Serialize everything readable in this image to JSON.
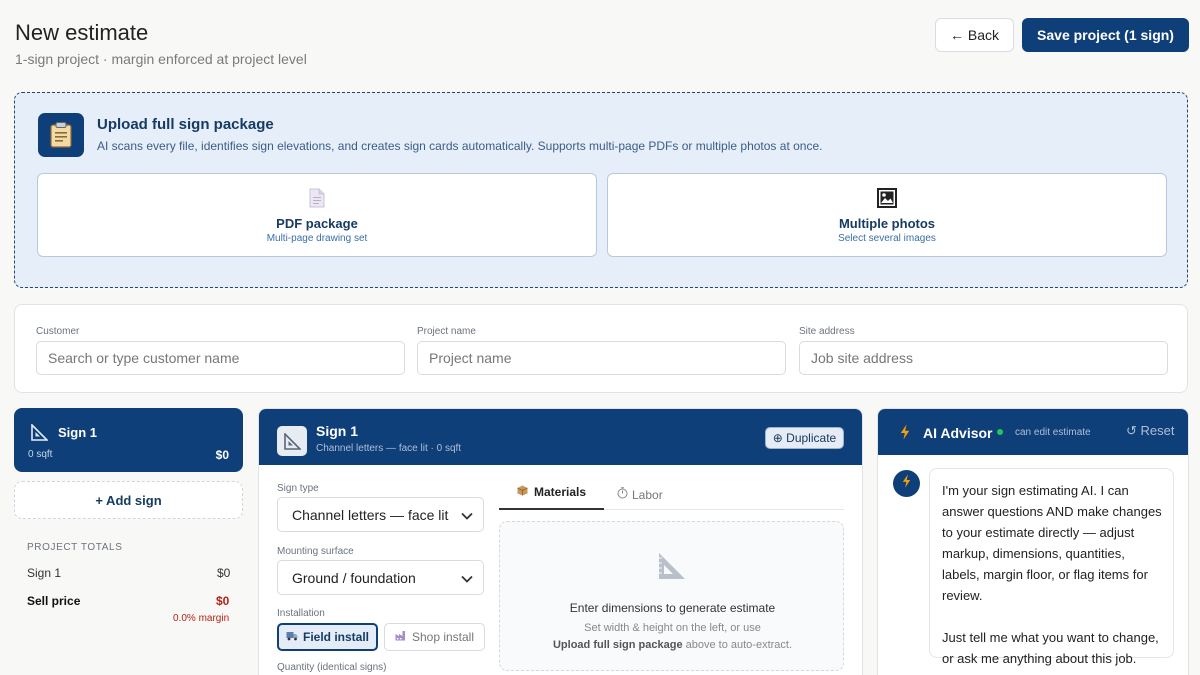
{
  "header": {
    "title": "New estimate",
    "subtitle": "1-sign project · margin enforced at project level",
    "back_label": "← Back",
    "save_label": "Save project (1 sign)"
  },
  "upload": {
    "title": "Upload full sign package",
    "description": "AI scans every file, identifies sign elevations, and creates sign cards automatically. Supports multi-page PDFs or multiple photos at once.",
    "pdf": {
      "label": "PDF package",
      "hint": "Multi-page drawing set",
      "icon": "document-icon"
    },
    "photos": {
      "label": "Multiple photos",
      "hint": "Select several images",
      "icon": "photos-icon"
    }
  },
  "fields": {
    "customer": {
      "label": "Customer",
      "placeholder": "Search or type customer name"
    },
    "project": {
      "label": "Project name",
      "placeholder": "Project name"
    },
    "site": {
      "label": "Site address",
      "placeholder": "Job site address"
    }
  },
  "sidebar": {
    "sign": {
      "name": "Sign 1",
      "area": "0 sqft",
      "price": "$0"
    },
    "add_label": "+ Add sign",
    "totals": {
      "heading": "PROJECT TOTALS",
      "row_label": "Sign 1",
      "row_value": "$0",
      "sell_label": "Sell price",
      "sell_value": "$0",
      "margin": "0.0% margin"
    }
  },
  "editor": {
    "title": "Sign 1",
    "subtitle": "Channel letters — face lit · 0 sqft",
    "duplicate_label": "⊕ Duplicate",
    "sign_type": {
      "label": "Sign type",
      "value": "Channel letters — face lit"
    },
    "mounting": {
      "label": "Mounting surface",
      "value": "Ground / foundation"
    },
    "installation": {
      "label": "Installation",
      "field_label": "Field install",
      "shop_label": "Shop install",
      "selected": "Field install"
    },
    "quantity_label": "Quantity (identical signs)",
    "tabs": {
      "materials": "Materials",
      "labor": "Labor",
      "active": "Materials"
    },
    "empty": {
      "title": "Enter dimensions to generate estimate",
      "line1": "Set width & height on the left, or use",
      "line2_bold": "Upload full sign package",
      "line2_rest": " above to auto-extract."
    }
  },
  "advisor": {
    "title": "AI Advisor",
    "status": "can edit estimate",
    "reset_label": "↺ Reset",
    "message_p1": "I'm your sign estimating AI. I can answer questions AND make changes to your estimate directly — adjust markup, dimensions, quantities, labels, margin floor, or flag items for review.",
    "message_p2": "Just tell me what you want to change, or ask me anything about this job."
  },
  "colors": {
    "primary": "#0f3f78",
    "upload_bg": "#e6eef9",
    "accent_orange": "#f59e0b",
    "status_green": "#22c55e",
    "danger_red": "#b42318"
  }
}
